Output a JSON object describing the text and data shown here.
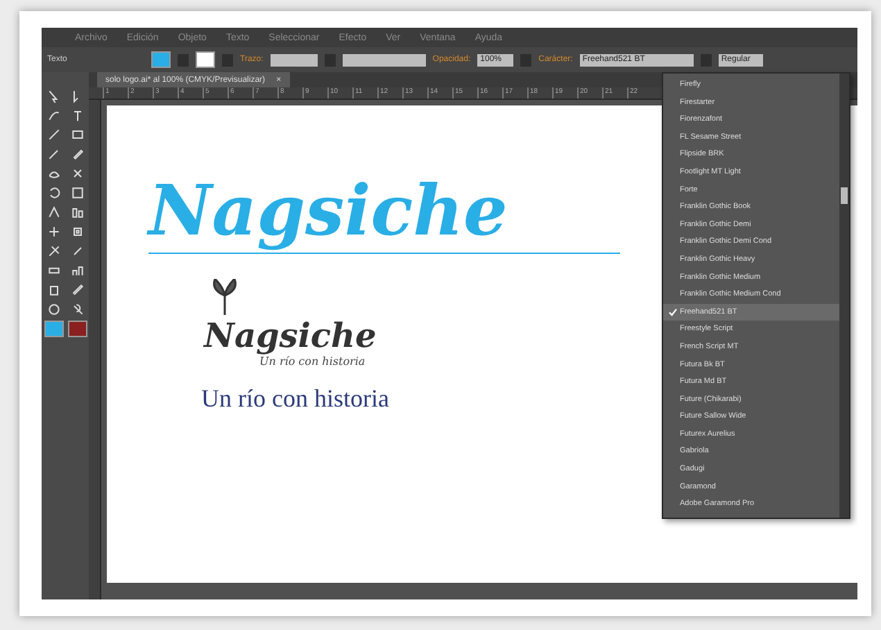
{
  "menu": [
    "Archivo",
    "Edición",
    "Objeto",
    "Texto",
    "Seleccionar",
    "Efecto",
    "Ver",
    "Ventana",
    "Ayuda"
  ],
  "control_bar": {
    "label": "Texto",
    "stroke_label": "Trazo:",
    "opacity_label": "Opacidad:",
    "opacity": "100%",
    "character_label": "Carácter:",
    "font": "Freehand521 BT",
    "style": "Regular"
  },
  "document_tab": {
    "title": "solo logo.ai* al 100% (CMYK/Previsualizar)",
    "close": "×"
  },
  "ruler": [
    "1",
    "2",
    "3",
    "4",
    "5",
    "6",
    "7",
    "8",
    "9",
    "10",
    "11",
    "12",
    "13",
    "14",
    "15",
    "16",
    "17",
    "18",
    "19",
    "20",
    "21",
    "22"
  ],
  "artboard": {
    "headline": "Nagsiche",
    "logo_name": "Nagsiche",
    "logo_tagline": "Un río con historia",
    "tagline": "Un río con historia"
  },
  "font_list": [
    {
      "name": "Firefly",
      "selected": false
    },
    {
      "name": "Firestarter",
      "selected": false
    },
    {
      "name": "Fiorenzafont",
      "selected": false
    },
    {
      "name": "FL Sesame Street",
      "selected": false
    },
    {
      "name": "Flipside BRK",
      "selected": false
    },
    {
      "name": "Footlight MT Light",
      "selected": false
    },
    {
      "name": "Forte",
      "selected": false
    },
    {
      "name": "Franklin Gothic Book",
      "selected": false
    },
    {
      "name": "Franklin Gothic Demi",
      "selected": false
    },
    {
      "name": "Franklin Gothic Demi Cond",
      "selected": false
    },
    {
      "name": "Franklin Gothic Heavy",
      "selected": false
    },
    {
      "name": "Franklin Gothic Medium",
      "selected": false
    },
    {
      "name": "Franklin Gothic Medium Cond",
      "selected": false
    },
    {
      "name": "Freehand521 BT",
      "selected": true
    },
    {
      "name": "Freestyle Script",
      "selected": false
    },
    {
      "name": "French Script MT",
      "selected": false
    },
    {
      "name": "Futura Bk BT",
      "selected": false
    },
    {
      "name": "Futura Md BT",
      "selected": false
    },
    {
      "name": "Future (Chikarabi)",
      "selected": false
    },
    {
      "name": "Future Sallow Wide",
      "selected": false
    },
    {
      "name": "Futurex Aurelius",
      "selected": false
    },
    {
      "name": "Gabriola",
      "selected": false
    },
    {
      "name": "Gadugi",
      "selected": false
    },
    {
      "name": "Garamond",
      "selected": false
    },
    {
      "name": "Adobe Garamond Pro",
      "selected": false
    }
  ]
}
